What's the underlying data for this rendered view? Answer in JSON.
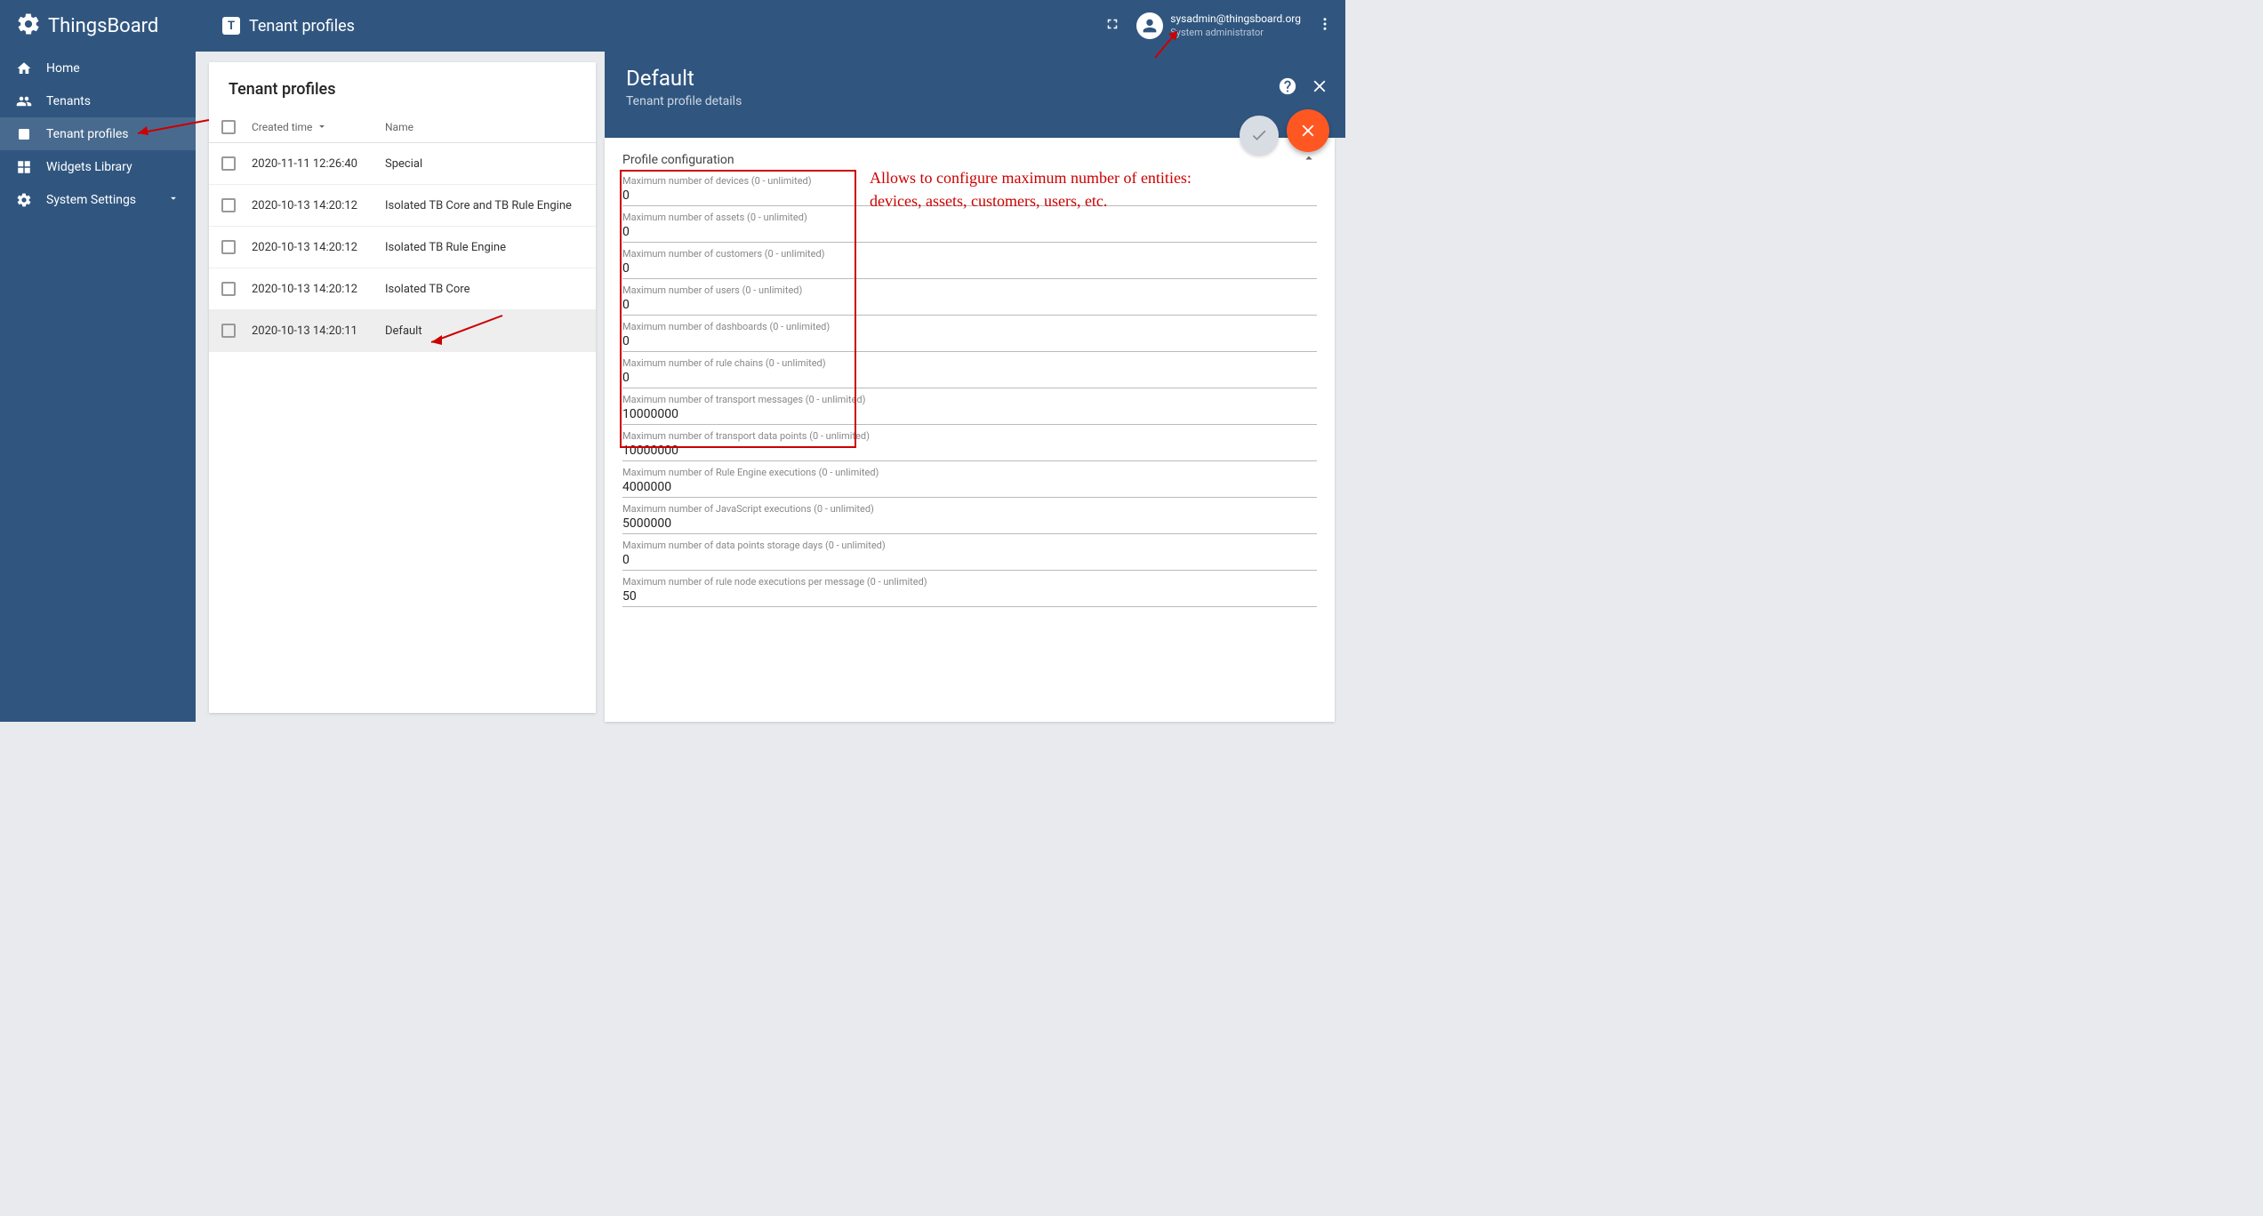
{
  "app": {
    "name": "ThingsBoard",
    "pageTitle": "Tenant profiles"
  },
  "user": {
    "email": "sysadmin@thingsboard.org",
    "role": "System administrator"
  },
  "sidebar": {
    "items": [
      {
        "label": "Home"
      },
      {
        "label": "Tenants"
      },
      {
        "label": "Tenant profiles"
      },
      {
        "label": "Widgets Library"
      },
      {
        "label": "System Settings"
      }
    ]
  },
  "table": {
    "title": "Tenant profiles",
    "cols": {
      "time": "Created time",
      "name": "Name"
    },
    "rows": [
      {
        "time": "2020-11-11 12:26:40",
        "name": "Special"
      },
      {
        "time": "2020-10-13 14:20:12",
        "name": "Isolated TB Core and TB Rule Engine"
      },
      {
        "time": "2020-10-13 14:20:12",
        "name": "Isolated TB Rule Engine"
      },
      {
        "time": "2020-10-13 14:20:12",
        "name": "Isolated TB Core"
      },
      {
        "time": "2020-10-13 14:20:11",
        "name": "Default"
      }
    ]
  },
  "details": {
    "title": "Default",
    "subtitle": "Tenant profile details",
    "section": "Profile configuration",
    "fields": [
      {
        "label": "Maximum number of devices (0 - unlimited)",
        "value": "0"
      },
      {
        "label": "Maximum number of assets (0 - unlimited)",
        "value": "0"
      },
      {
        "label": "Maximum number of customers (0 - unlimited)",
        "value": "0"
      },
      {
        "label": "Maximum number of users (0 - unlimited)",
        "value": "0"
      },
      {
        "label": "Maximum number of dashboards (0 - unlimited)",
        "value": "0"
      },
      {
        "label": "Maximum number of rule chains (0 - unlimited)",
        "value": "0"
      },
      {
        "label": "Maximum number of transport messages (0 - unlimited)",
        "value": "10000000"
      },
      {
        "label": "Maximum number of transport data points (0 - unlimited)",
        "value": "10000000"
      },
      {
        "label": "Maximum number of Rule Engine executions (0 - unlimited)",
        "value": "4000000"
      },
      {
        "label": "Maximum number of JavaScript executions (0 - unlimited)",
        "value": "5000000"
      },
      {
        "label": "Maximum number of data points storage days (0 - unlimited)",
        "value": "0"
      },
      {
        "label": "Maximum number of rule node executions per message (0 - unlimited)",
        "value": "50"
      }
    ]
  },
  "annotation": {
    "text1": "Allows to configure maximum number of entities:",
    "text2": "devices, assets, customers, users, etc."
  }
}
